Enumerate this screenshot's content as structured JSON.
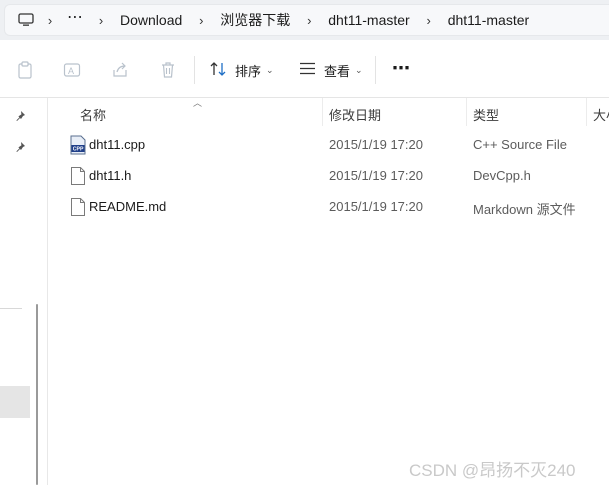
{
  "breadcrumb": {
    "overflow": "⋯",
    "items": [
      "Download",
      "浏览器下载",
      "dht11-master",
      "dht11-master"
    ]
  },
  "toolbar": {
    "sort_label": "排序",
    "view_label": "查看",
    "more": "⋯"
  },
  "columns": {
    "name": "名称",
    "date": "修改日期",
    "type": "类型",
    "size": "大小"
  },
  "files": [
    {
      "name": "dht11.cpp",
      "date": "2015/1/19 17:20",
      "type": "C++ Source File",
      "icon": "cpp-file-icon"
    },
    {
      "name": "dht11.h",
      "date": "2015/1/19 17:20",
      "type": "DevCpp.h",
      "icon": "document-icon"
    },
    {
      "name": "README.md",
      "date": "2015/1/19 17:20",
      "type": "Markdown 源文件",
      "icon": "document-icon"
    }
  ],
  "watermark": "CSDN @昂扬不灭240"
}
